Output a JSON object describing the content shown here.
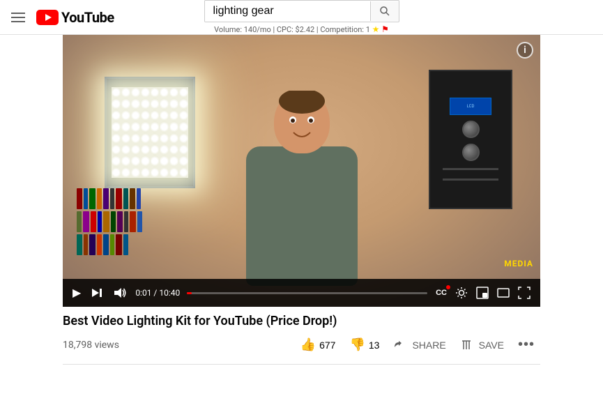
{
  "header": {
    "hamburger_label": "Menu",
    "logo_text": "YouTube",
    "search_value": "lighting gear",
    "search_placeholder": "Search",
    "search_hint": "Volume: 140/mo | CPC: $2.42 | Competition: 1"
  },
  "video": {
    "title": "Best Video Lighting Kit for YouTube (Price Drop!)",
    "views": "18,798 views",
    "time_current": "0:01",
    "time_total": "10:40",
    "time_display": "0:01 / 10:40",
    "media_watermark": "MEDIA",
    "info_btn_label": "i"
  },
  "actions": {
    "like_icon": "👍",
    "like_count": "677",
    "dislike_icon": "👎",
    "dislike_count": "13",
    "share_label": "SHARE",
    "save_label": "SAVE",
    "more_label": "..."
  },
  "controls": {
    "play_btn": "▶",
    "skip_btn": "⏭",
    "volume_btn": "🔊",
    "cc_btn": "CC",
    "settings_btn": "⚙",
    "miniplayer_btn": "⧉",
    "theater_btn": "▬",
    "fullscreen_btn": "⛶"
  }
}
